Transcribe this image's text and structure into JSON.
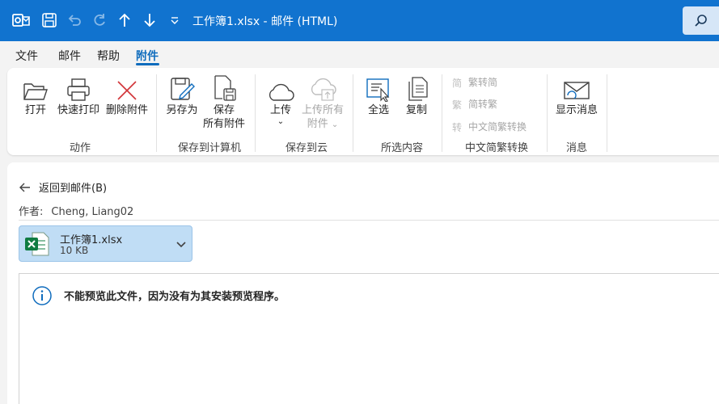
{
  "window": {
    "title": "工作簿1.xlsx  -  邮件 (HTML)"
  },
  "menu": {
    "items": [
      "文件",
      "邮件",
      "帮助",
      "附件"
    ],
    "active": "附件"
  },
  "ribbon": {
    "open": "打开",
    "quick_print": "快速打印",
    "remove_attachment": "删除附件",
    "group_actions": "动作",
    "save_as": "另存为",
    "save_all_line1": "保存",
    "save_all_line2": "所有附件",
    "group_save_computer": "保存到计算机",
    "upload": "上传",
    "upload_all_line1": "上传所有",
    "upload_all_line2": "附件",
    "group_save_cloud": "保存到云",
    "select_all": "全选",
    "copy": "复制",
    "group_selection": "所选内容",
    "to_traditional": "繁转简",
    "to_simplified": "简转繁",
    "convert": "中文简繁转换",
    "group_chinese": "中文简繁转换",
    "show_message": "显示消息",
    "group_message": "消息"
  },
  "content": {
    "back_label": "返回到邮件(B)",
    "author_label": "作者:",
    "author_value": "Cheng, Liang02",
    "attachment_name": "工作簿1.xlsx",
    "attachment_size": "10 KB",
    "preview_message": "不能预览此文件，因为没有为其安装预览程序。"
  },
  "colors": {
    "titlebar": "#1173cf",
    "accent": "#0f6cbd",
    "attachment_bg": "#c0ddf5",
    "excel_green": "#107c41"
  }
}
